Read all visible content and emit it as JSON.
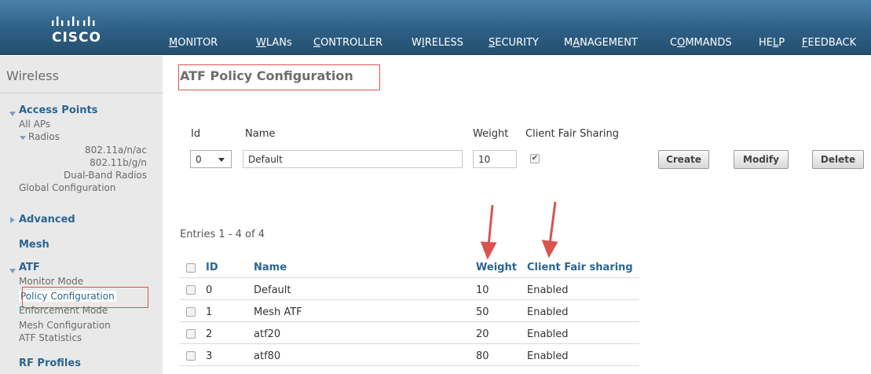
{
  "brand": {
    "logo_text": "CISCO"
  },
  "nav": [
    {
      "pre": "",
      "u": "M",
      "post": "ONITOR"
    },
    {
      "pre": "",
      "u": "W",
      "post": "LANs"
    },
    {
      "pre": "",
      "u": "C",
      "post": "ONTROLLER"
    },
    {
      "pre": "W",
      "u": "I",
      "post": "RELESS"
    },
    {
      "pre": "",
      "u": "S",
      "post": "ECURITY"
    },
    {
      "pre": "M",
      "u": "A",
      "post": "NAGEMENT"
    },
    {
      "pre": "C",
      "u": "O",
      "post": "MMANDS"
    },
    {
      "pre": "HE",
      "u": "L",
      "post": "P"
    },
    {
      "pre": "",
      "u": "F",
      "post": "EEDBACK"
    }
  ],
  "sidebar": {
    "title": "Wireless",
    "access_points": "Access Points",
    "all_aps": "All APs",
    "radios": "Radios",
    "radio_a": "802.11a/n/ac",
    "radio_b": "802.11b/g/n",
    "radio_dual": "Dual-Band Radios",
    "global_config": "Global Configuration",
    "advanced": "Advanced",
    "mesh": "Mesh",
    "atf": "ATF",
    "monitor_mode": "Monitor Mode",
    "policy_config": "Policy Configuration",
    "enforcement_mode": "Enforcement Mode",
    "mesh_config": "Mesh Configuration",
    "atf_statistics": "ATF Statistics",
    "rf_profiles": "RF Profiles"
  },
  "page": {
    "title": "ATF Policy Configuration"
  },
  "form": {
    "id_label": "Id",
    "name_label": "Name",
    "weight_label": "Weight",
    "cfs_label": "Client Fair Sharing",
    "id_value": "0",
    "name_value": "Default",
    "weight_value": "10",
    "cfs_checked": "✔",
    "create": "Create",
    "modify": "Modify",
    "delete": "Delete"
  },
  "entries_text": "Entries 1 - 4 of 4",
  "table": {
    "headers": {
      "id": "ID",
      "name": "Name",
      "weight": "Weight",
      "cfs": "Client Fair sharing"
    },
    "rows": [
      {
        "id": "0",
        "name": "Default",
        "weight": "10",
        "cfs": "Enabled"
      },
      {
        "id": "1",
        "name": "Mesh ATF",
        "weight": "50",
        "cfs": "Enabled"
      },
      {
        "id": "2",
        "name": "atf20",
        "weight": "20",
        "cfs": "Enabled"
      },
      {
        "id": "3",
        "name": "atf80",
        "weight": "80",
        "cfs": "Enabled"
      }
    ]
  },
  "colors": {
    "header_bg": "#2e5f85",
    "accent_link": "#2a6592",
    "highlight": "#d9534f",
    "sidebar_bg": "#e9e9e9"
  }
}
